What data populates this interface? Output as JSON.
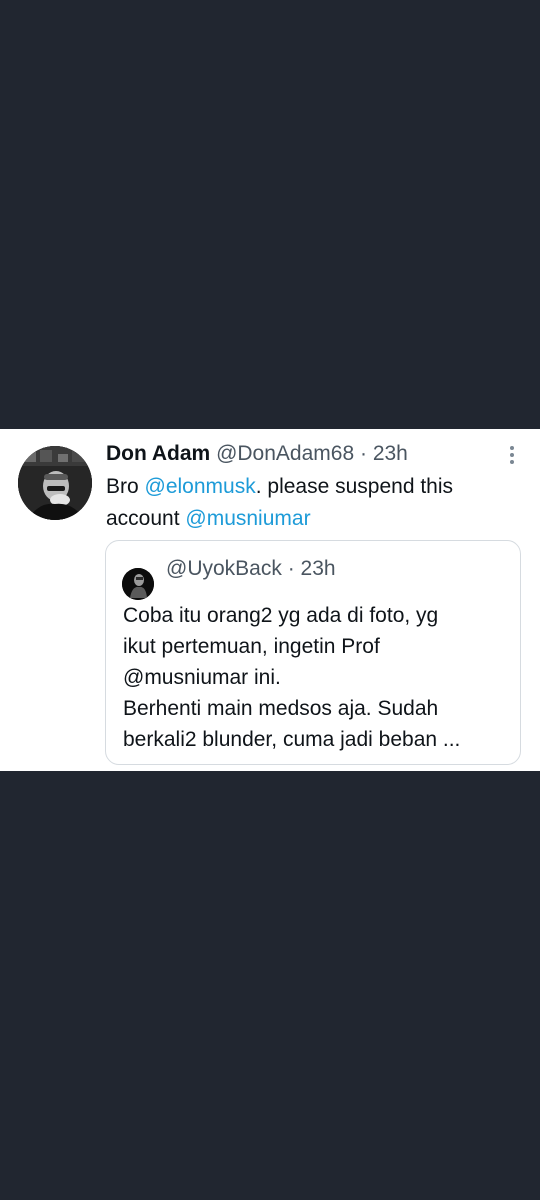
{
  "tweet": {
    "author_name": "Don Adam",
    "author_handle": "@DonAdam68",
    "separator": "·",
    "timestamp": "23h",
    "text_prefix": "Bro ",
    "mention_1": "@elonmusk",
    "text_middle": ". please suspend this account ",
    "mention_2": "@musniumar",
    "more_icon": "vertical-ellipsis-icon"
  },
  "quoted_tweet": {
    "author_handle": "@UyokBack",
    "separator": "·",
    "timestamp": "23h",
    "lines": [
      "Coba itu orang2 yg ada di foto, yg",
      "ikut pertemuan, ingetin Prof",
      "@musniumar ini.",
      "Berhenti main medsos aja. Sudah",
      "berkali2 blunder, cuma jadi beban ..."
    ]
  },
  "colors": {
    "background": "#212630",
    "card": "#ffffff",
    "mention": "#1d9bd8",
    "secondary_text": "#4a5560",
    "primary_text": "#0f1419",
    "border": "#d6dbe0"
  }
}
